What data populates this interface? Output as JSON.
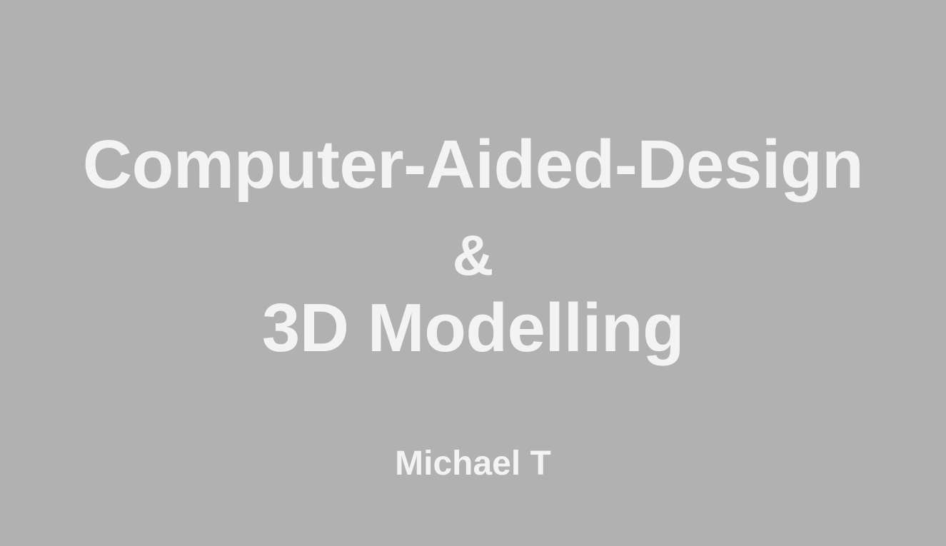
{
  "slide": {
    "title_lines": [
      "Computer-Aided-Design",
      "&",
      "3D Modelling"
    ],
    "author": "Michael T"
  },
  "colors": {
    "background": "#b1b1b1",
    "text": "#f3f3f3"
  }
}
